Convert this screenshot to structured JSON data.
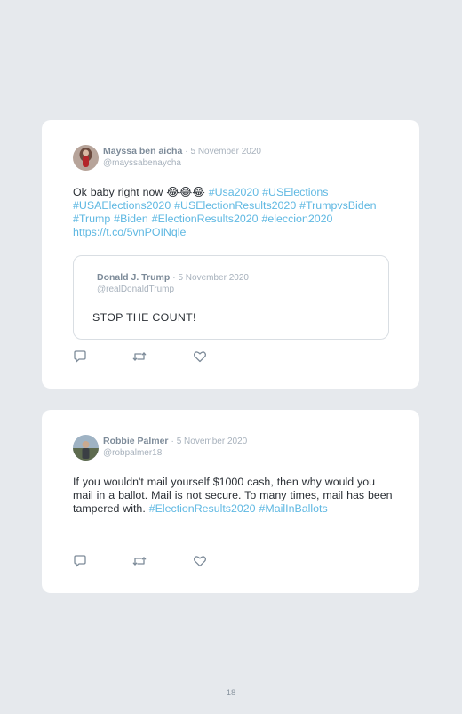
{
  "tweets": [
    {
      "author": "Mayssa ben aicha",
      "separator": "·",
      "date": "5 November 2020",
      "handle": "@mayssabenaycha",
      "text_plain": "Ok baby right now 😂😂😂 ",
      "text_links": "#Usa2020 #USElections #USAElections2020 #USElectionResults2020 #TrumpvsBiden #Trump #Biden #ElectionResults2020 #eleccion2020 https://t.co/5vnPOINqle",
      "quoted": {
        "author": "Donald J. Trump",
        "separator": "·",
        "date": "5 November 2020",
        "handle": "@realDonaldTrump",
        "text": "STOP THE COUNT!"
      }
    },
    {
      "author": "Robbie Palmer",
      "separator": "·",
      "date": "5 November 2020",
      "handle": "@robpalmer18",
      "text_plain": "If you wouldn't mail yourself $1000 cash, then why would you mail in a ballot. Mail is not secure. To many times, mail has been tampered with. ",
      "text_links": "#ElectionResults2020 #MailInBallots"
    }
  ],
  "icons": {
    "reply": "reply-icon",
    "retweet": "retweet-icon",
    "like": "heart-icon"
  },
  "colors": {
    "background": "#e6e9ed",
    "card": "#ffffff",
    "link": "#5fb8e2",
    "name": "#7d8b99",
    "muted": "#a7b1bc",
    "text": "#2a2f35"
  },
  "page_number": "18"
}
